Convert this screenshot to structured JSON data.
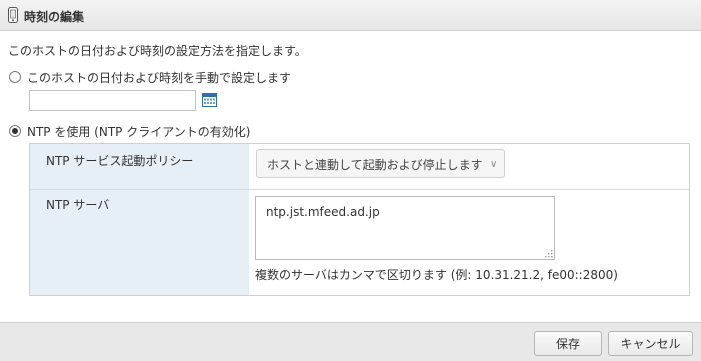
{
  "dialog": {
    "title": "時刻の編集"
  },
  "description": "このホストの日付および時刻の設定方法を指定します。",
  "manual_option": {
    "label": "このホストの日付および時刻を手動で設定します",
    "date_value": ""
  },
  "ntp_option": {
    "label": "NTP を使用 (NTP クライアントの有効化)"
  },
  "ntp_settings": {
    "policy_label": "NTP サービス起動ポリシー",
    "policy_value": "ホストと連動して起動および停止します",
    "server_label": "NTP サーバ",
    "server_value": "ntp.jst.mfeed.ad.jp",
    "server_help": "複数のサーバはカンマで区切ります (例: 10.31.21.2, fe00::2800)"
  },
  "footer": {
    "save_label": "保存",
    "cancel_label": "キャンセル"
  },
  "colors": {
    "label_column_bg": "#e6eef6",
    "footer_bg": "#e8e8e8"
  }
}
